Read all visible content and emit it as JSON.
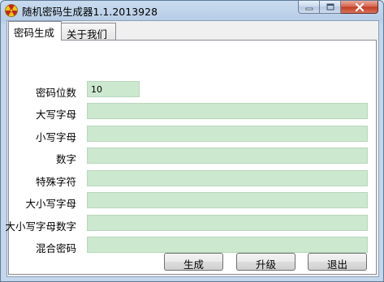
{
  "window": {
    "title": "随机密码生成器1.1.2013928",
    "icon": "radiation-icon",
    "colors": {
      "field_bg": "#cce8cf",
      "close_red": "#c23b20"
    }
  },
  "tabs": [
    {
      "label": "密码生成",
      "active": true
    },
    {
      "label": "关于我们",
      "active": false
    }
  ],
  "form": {
    "rows": [
      {
        "label": "密码位数",
        "value": "10"
      },
      {
        "label": "大写字母",
        "value": ""
      },
      {
        "label": "小写字母",
        "value": ""
      },
      {
        "label": "数字",
        "value": ""
      },
      {
        "label": "特殊字符",
        "value": ""
      },
      {
        "label": "大小写字母",
        "value": ""
      },
      {
        "label": "大小写字母数字",
        "value": ""
      },
      {
        "label": "混合密码",
        "value": ""
      }
    ]
  },
  "buttons": {
    "generate": "生成",
    "upgrade": "升级",
    "exit": "退出"
  }
}
